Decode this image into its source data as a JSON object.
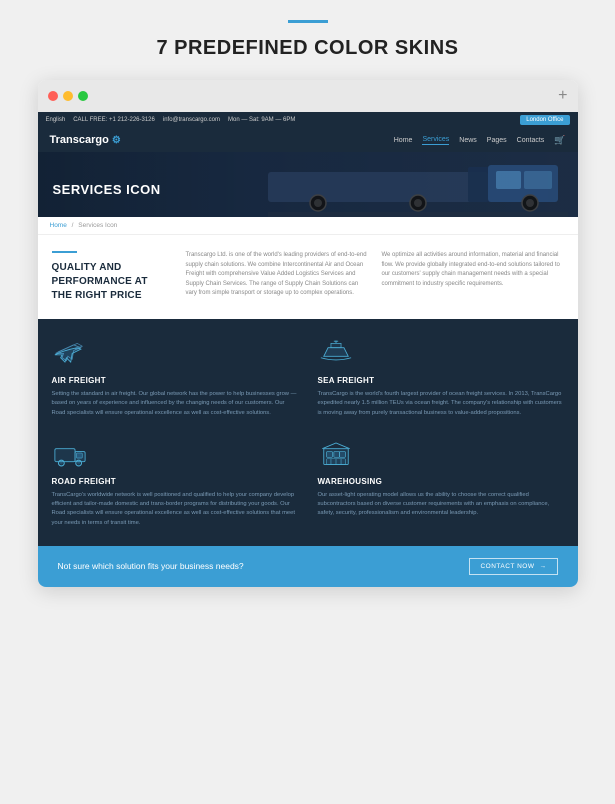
{
  "page": {
    "accent_label": "",
    "heading": "7 PREDEFINED COLOR SKINS"
  },
  "browser": {
    "plus_label": "+"
  },
  "topbar": {
    "language": "English",
    "phone_label": "CALL FREE:",
    "phone": "+1 212-226-3126",
    "email": "info@transcargo.com",
    "hours": "Mon — Sat: 9AM — 6PM",
    "office_button": "London Office"
  },
  "navbar": {
    "logo": "Transcargo",
    "nav_items": [
      {
        "label": "Home",
        "active": false
      },
      {
        "label": "Services",
        "active": true
      },
      {
        "label": "News",
        "active": false
      },
      {
        "label": "Pages",
        "active": false
      },
      {
        "label": "Contacts",
        "active": false
      }
    ]
  },
  "hero": {
    "title": "SERVICES ICON"
  },
  "breadcrumb": {
    "home": "Home",
    "separator": "/",
    "current": "Services Icon"
  },
  "content": {
    "accent": "",
    "heading": "QUALITY AND\nPERFORMANCE AT\nTHE RIGHT PRICE",
    "body1": "Transcargo Ltd. is one of the world's leading providers of end-to-end supply chain solutions. We combine Intercontinental Air and Ocean Freight with comprehensive Value Added Logistics Services and Supply Chain Services. The range of Supply Chain Solutions can vary from simple transport or storage up to complex operations.",
    "body2": "We optimize all activities around information, material and financial flow. We provide globally integrated end-to-end solutions tailored to our customers' supply chain management needs with a special commitment to industry specific requirements."
  },
  "services": [
    {
      "id": "air",
      "title": "AIR FREIGHT",
      "desc": "Setting the standard in air freight. Our global network has the power to help businesses grow — based on years of experience and influenced by the changing needs of our customers. Our Road specialists will ensure operational excellence as well as cost-effective solutions.",
      "icon_type": "plane"
    },
    {
      "id": "sea",
      "title": "SEA FREIGHT",
      "desc": "TransCargo is the world's fourth largest provider of ocean freight services. In 2013, TransCargo expedited nearly 1.5 million TEUs via ocean freight. The company's relationship with customers is moving away from purely transactional business to value-added propositions.",
      "icon_type": "ship"
    },
    {
      "id": "road",
      "title": "ROAD FREIGHT",
      "desc": "TransCargo's worldwide network is well positioned and qualified to help your company develop efficient and tailor-made domestic and trans-border programs for distributing your goods. Our Road specialists will ensure operational excellence as well as cost-effective solutions that meet your needs in terms of transit time.",
      "icon_type": "truck"
    },
    {
      "id": "warehouse",
      "title": "WAREHOUSING",
      "desc": "Our asset-light operating model allows us the ability to choose the correct qualified subcontractors based on diverse customer requirements with an emphasis on compliance, safety, security, professionalism and environmental leadership.",
      "icon_type": "box"
    }
  ],
  "cta": {
    "text": "Not sure which solution fits your business needs?",
    "button": "CONTACT NOW",
    "arrow": "→"
  }
}
